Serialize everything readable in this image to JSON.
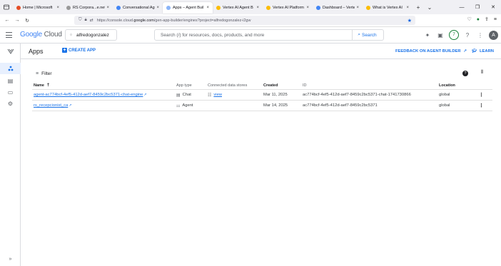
{
  "browser": {
    "tabs": [
      {
        "title": "Home | Microsoft",
        "color": "#e44d26",
        "active": false
      },
      {
        "title": "RS Corpora...e.net",
        "color": "#999999",
        "active": false
      },
      {
        "title": "Conversational Ag",
        "color": "#4285f4",
        "active": false
      },
      {
        "title": "Apps – Agent Buil",
        "color": "#8ab4f8",
        "active": true
      },
      {
        "title": "Vertex AI Agent B",
        "color": "#fbbc04",
        "active": false
      },
      {
        "title": "Vertex AI Platform",
        "color": "#fbbc04",
        "active": false
      },
      {
        "title": "Dashboard – Verte",
        "color": "#4285f4",
        "active": false
      },
      {
        "title": "What is Vertex AI",
        "color": "#fbbc04",
        "active": false
      }
    ],
    "url_prefix": "https://console.cloud.",
    "url_domain": "google.com",
    "url_path": "/gen-app-builder/engines?project=alfredogonzalez-i2gw"
  },
  "header": {
    "logo_google": "Google",
    "logo_cloud": "Cloud",
    "project": "alfredogonzalez",
    "search_placeholder": "Search (/) for resources, docs, products, and more",
    "search_button": "Search",
    "avatar_letter": "A"
  },
  "page": {
    "title": "Apps",
    "create_label": "CREATE APP",
    "feedback_label": "FEEDBACK ON AGENT BUILDER",
    "learn_label": "LEARN",
    "filter_label": "Filter"
  },
  "table": {
    "columns": [
      "Name",
      "App type",
      "Connected data stores",
      "Created",
      "ID",
      "Location"
    ],
    "rows": [
      {
        "name": "agent-ac774bcf-4ef5-412d-aef7-8459c2bc5371-chat-engine",
        "type": "Chat",
        "type_icon": "chat-icon",
        "store": "view",
        "created": "Mar 11, 2025",
        "id": "ac774bcf-4ef5-412d-aef7-8459c2bc5371-chat-1741730866",
        "location": "global"
      },
      {
        "name": "rs_recepcionist_ca",
        "type": "Agent",
        "type_icon": "agent-icon",
        "store": "",
        "created": "Mar 14, 2025",
        "id": "ac774bcf-4ef5-412d-aef7-8459c2bc5371",
        "location": "global"
      }
    ]
  },
  "colors": {
    "accent": "#1a73e8",
    "nav_active_bg": "#e8f0fe"
  }
}
